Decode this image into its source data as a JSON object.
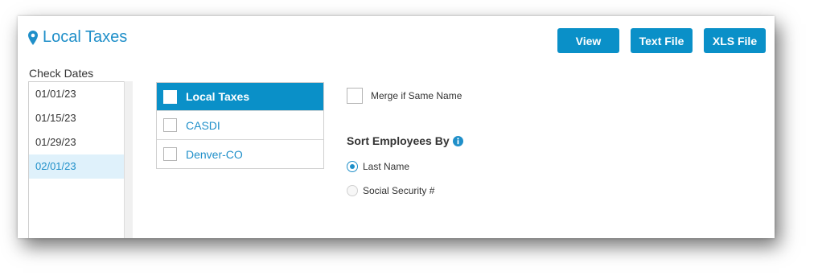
{
  "page": {
    "title": "Local Taxes",
    "title_icon": "map-marker-icon",
    "accent_color": "#0a90c8"
  },
  "toolbar": {
    "view_label": "View",
    "text_file_label": "Text File",
    "xls_file_label": "XLS File"
  },
  "check_dates": {
    "label": "Check Dates",
    "items": [
      "01/01/23",
      "01/15/23",
      "01/29/23",
      "02/01/23"
    ],
    "selected": "02/01/23"
  },
  "taxes": {
    "header": "Local Taxes",
    "rows": [
      "CASDI",
      "Denver-CO"
    ]
  },
  "options": {
    "merge_label": "Merge if Same Name",
    "merge_checked": false,
    "sort_title": "Sort Employees By",
    "sort_info_icon": "info-icon",
    "sort_options": [
      "Last Name",
      "Social Security #"
    ],
    "sort_selected": "Last Name"
  }
}
